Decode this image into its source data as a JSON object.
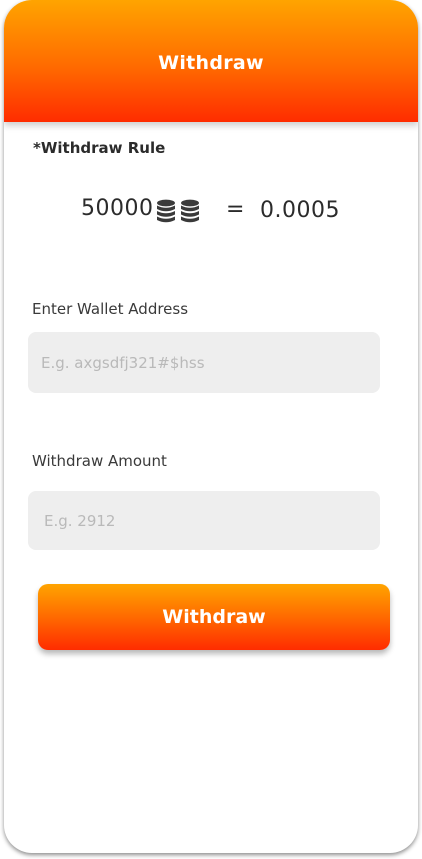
{
  "header": {
    "title": "Withdraw"
  },
  "rule": {
    "label": "*Withdraw Rule",
    "coins_amount": "50000",
    "coin_icon": "coins-stack-icon",
    "equals": "=",
    "converted_amount": "0.0005"
  },
  "wallet": {
    "label": "Enter Wallet Address",
    "placeholder": "E.g. axgsdfj321#$hss",
    "value": ""
  },
  "amount": {
    "label": "Withdraw Amount",
    "placeholder": "E.g. 2912",
    "value": ""
  },
  "actions": {
    "withdraw_label": "Withdraw"
  },
  "colors": {
    "accent_top": "#ffa400",
    "accent_bottom": "#ff2c00",
    "input_bg": "#eeeeee",
    "coin_icon": "#3a3a3a"
  }
}
